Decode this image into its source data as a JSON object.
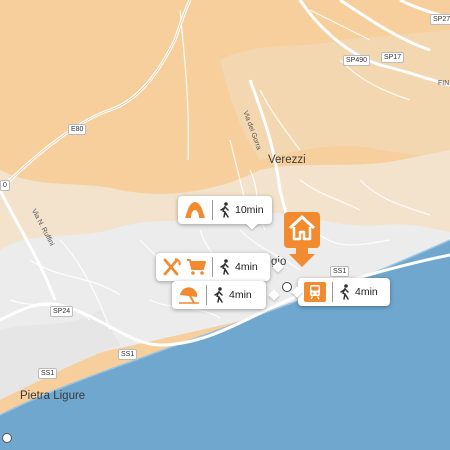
{
  "map": {
    "places": {
      "verezzi": "Verezzi",
      "pietra_ligure": "Pietra Ligure",
      "borgio_fragment": "gio",
      "fin_fragment": "FIN"
    },
    "roads": {
      "via_del_gorra": "Via dei Gorra",
      "via_n_ruffini": "Via N. Ruffini",
      "e80": "E80",
      "sp24": "SP24",
      "ss1_west": "SS1",
      "ss1_south": "SS1",
      "ss1_east": "SS1",
      "sp490": "SP490",
      "sp17": "SP17",
      "sp27": "SP27",
      "edge_0": "0"
    },
    "callouts": [
      {
        "id": "cave",
        "icons": [
          "cave-icon"
        ],
        "walk_time": "10min"
      },
      {
        "id": "food-shop",
        "icons": [
          "restaurant-icon",
          "shopping-cart-icon"
        ],
        "walk_time": "4min"
      },
      {
        "id": "beach",
        "icons": [
          "beach-umbrella-icon"
        ],
        "walk_time": "4min"
      },
      {
        "id": "train",
        "icons": [
          "train-icon"
        ],
        "walk_time": "4min"
      }
    ],
    "home_marker": "home-icon"
  },
  "colors": {
    "accent": "#f28a2f",
    "sea": "#6fa7cf",
    "land_orange": "#f7cf9d",
    "land_light": "#f3e3cc",
    "urban": "#ececec"
  }
}
